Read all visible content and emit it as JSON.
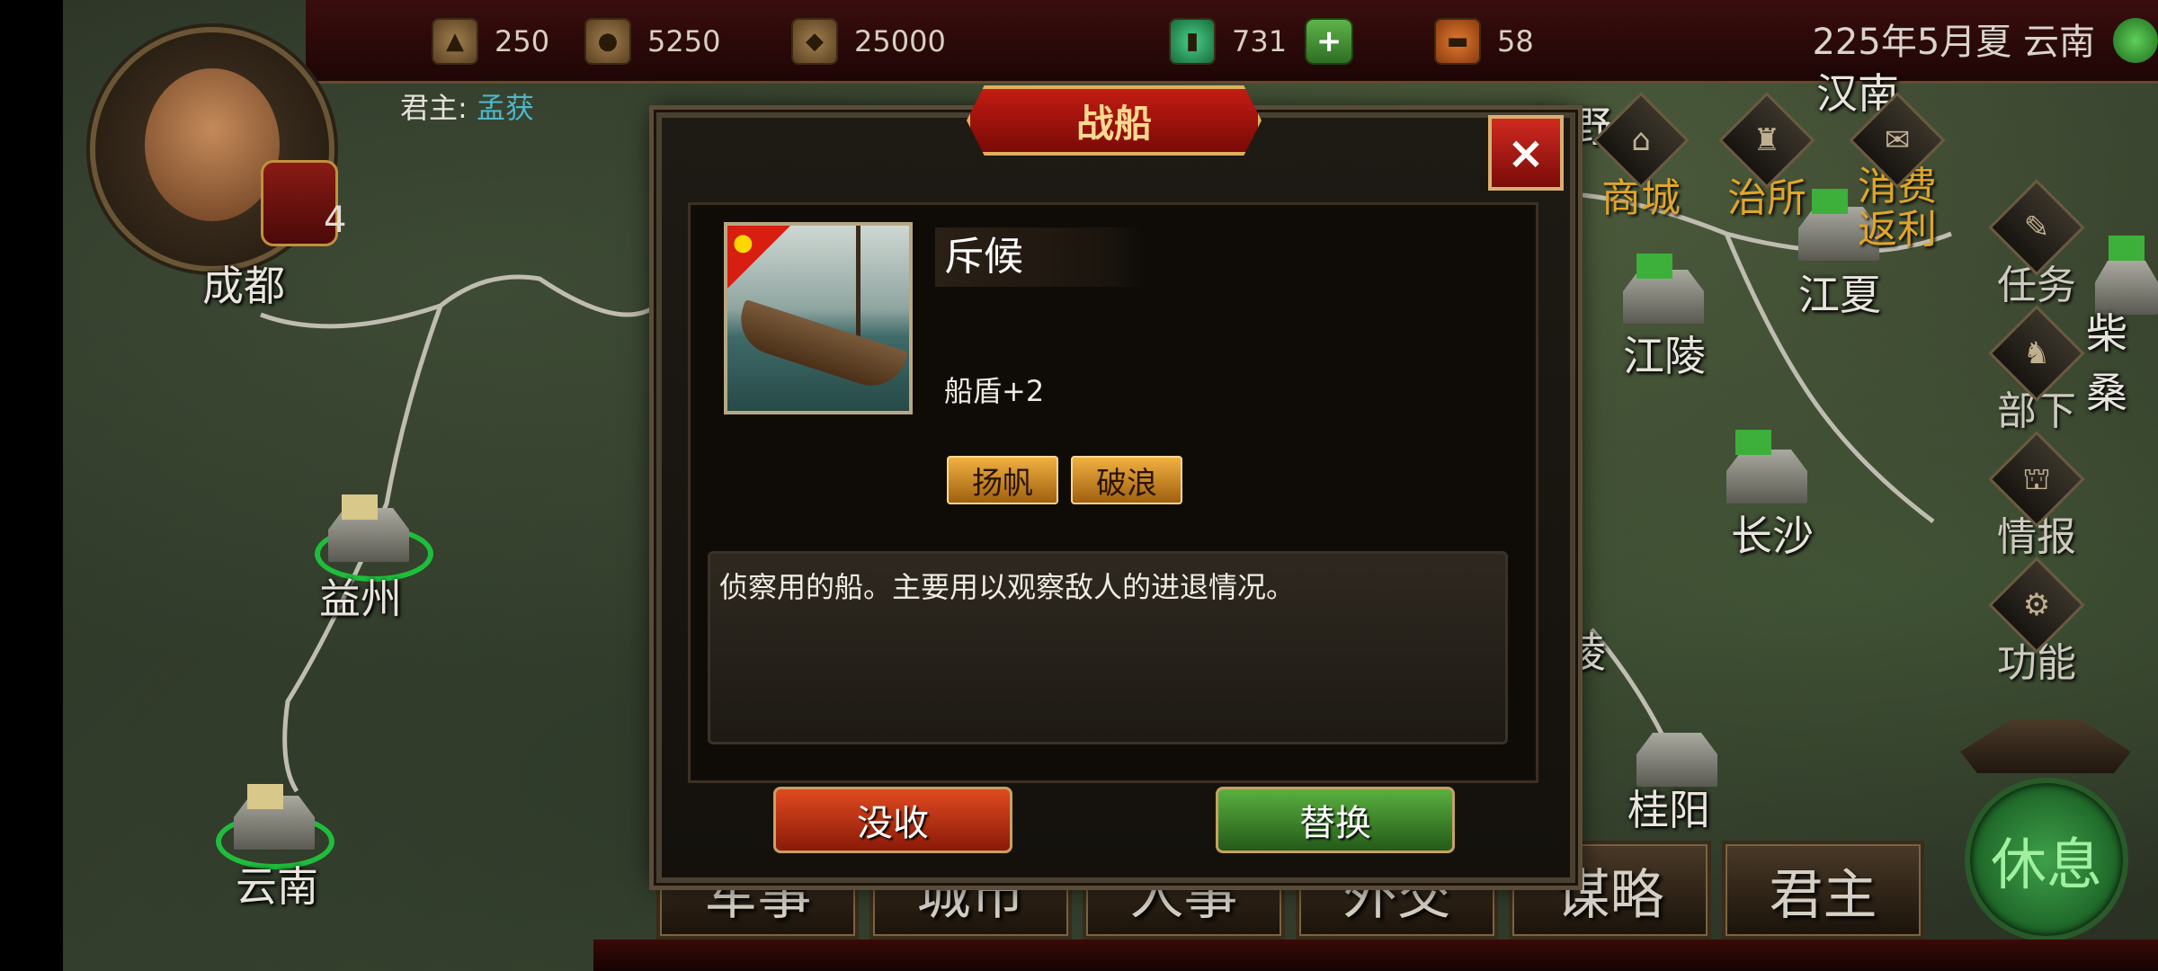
{
  "resources": [
    {
      "icon": "grain-sack-icon",
      "value": "250"
    },
    {
      "icon": "coin-sack-icon",
      "value": "5250"
    },
    {
      "icon": "troops-icon",
      "value": "25000"
    },
    {
      "icon": "jade-icon",
      "value": "731"
    },
    {
      "icon": "order-token-icon",
      "value": "58"
    }
  ],
  "date_region": "225年5月夏 云南",
  "lord": {
    "label": "君主: ",
    "name": "孟获",
    "level_badge": "4"
  },
  "map": {
    "cities": [
      "成都",
      "益州",
      "云南",
      "江陵",
      "江夏",
      "长沙",
      "桂阳",
      "柴桑",
      "新野",
      "汉南",
      "陵"
    ]
  },
  "right_menu": [
    {
      "label": "商城",
      "gold": true
    },
    {
      "label": "治所",
      "gold": true
    },
    {
      "label": "消费\n返利",
      "gold": true
    },
    {
      "label": "任务",
      "gold": false
    },
    {
      "label": "部下",
      "gold": false
    },
    {
      "label": "情报",
      "gold": false
    },
    {
      "label": "功能",
      "gold": false
    }
  ],
  "rest_button": "休息",
  "bottom_tabs": [
    "军事",
    "城市",
    "人事",
    "外交",
    "谋略",
    "君主"
  ],
  "dialog": {
    "title": "战船",
    "close": "×",
    "ship_name": "斥候",
    "stat": "船盾+2",
    "skills": [
      "扬帆",
      "破浪"
    ],
    "description": "侦察用的船。主要用以观察敌人的进退情况。",
    "confiscate_button": "没收",
    "replace_button": "替换"
  },
  "colors": {
    "accent_red": "#c21c12",
    "gold_text": "#e0a52a",
    "lord_name": "#4fb6c8",
    "confirm_green": "#5ab040"
  }
}
